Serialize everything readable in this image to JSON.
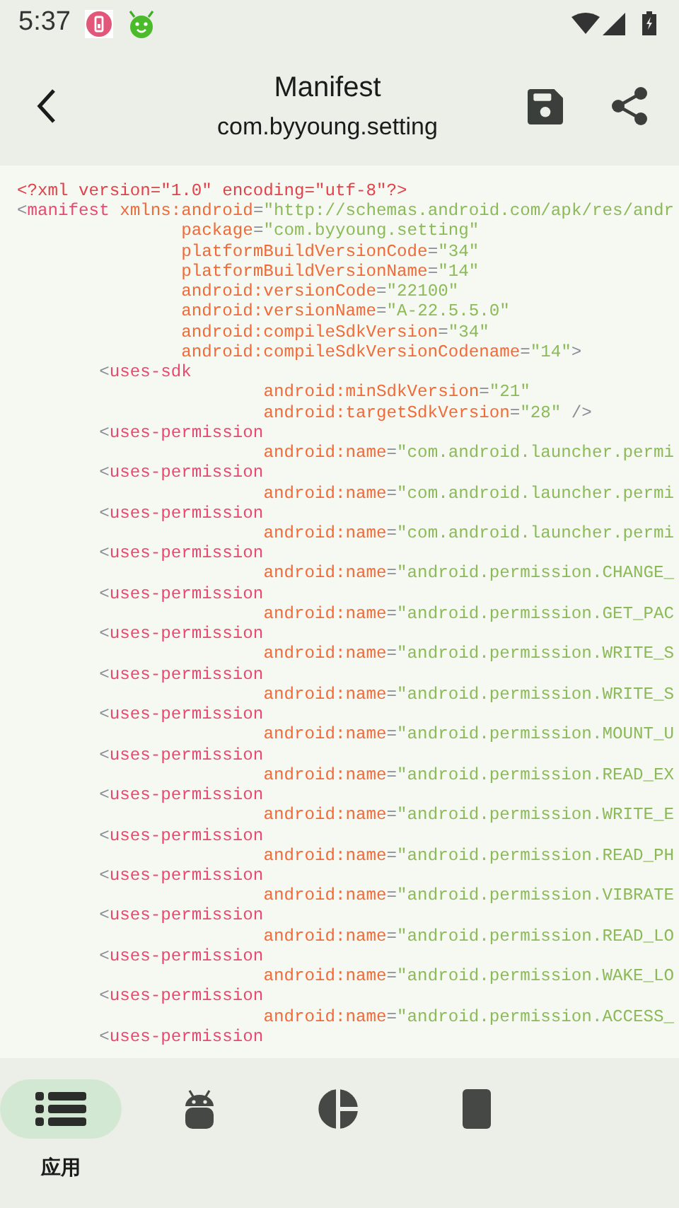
{
  "status_bar": {
    "time": "5:37"
  },
  "app_bar": {
    "title": "Manifest",
    "subtitle": "com.byyoung.setting"
  },
  "code_lines": [
    {
      "tokens": [
        {
          "kind": "decl",
          "text": "<?xml version=\"1.0\" encoding=\"utf-8\"?>"
        }
      ]
    },
    {
      "tokens": [
        {
          "kind": "punct",
          "text": "<"
        },
        {
          "kind": "tag",
          "text": "manifest "
        },
        {
          "kind": "attr",
          "text": "xmlns:android"
        },
        {
          "kind": "punct",
          "text": "="
        },
        {
          "kind": "value",
          "text": "\"http://schemas.android.com/apk/res/andr"
        }
      ]
    },
    {
      "tokens": [
        {
          "kind": "attr",
          "text": "                package"
        },
        {
          "kind": "punct",
          "text": "="
        },
        {
          "kind": "value",
          "text": "\"com.byyoung.setting\""
        }
      ]
    },
    {
      "tokens": [
        {
          "kind": "attr",
          "text": "                platformBuildVersionCode"
        },
        {
          "kind": "punct",
          "text": "="
        },
        {
          "kind": "value",
          "text": "\"34\""
        }
      ]
    },
    {
      "tokens": [
        {
          "kind": "attr",
          "text": "                platformBuildVersionName"
        },
        {
          "kind": "punct",
          "text": "="
        },
        {
          "kind": "value",
          "text": "\"14\""
        }
      ]
    },
    {
      "tokens": [
        {
          "kind": "attr",
          "text": "                android:versionCode"
        },
        {
          "kind": "punct",
          "text": "="
        },
        {
          "kind": "value",
          "text": "\"22100\""
        }
      ]
    },
    {
      "tokens": [
        {
          "kind": "attr",
          "text": "                android:versionName"
        },
        {
          "kind": "punct",
          "text": "="
        },
        {
          "kind": "value",
          "text": "\"A-22.5.5.0\""
        }
      ]
    },
    {
      "tokens": [
        {
          "kind": "attr",
          "text": "                android:compileSdkVersion"
        },
        {
          "kind": "punct",
          "text": "="
        },
        {
          "kind": "value",
          "text": "\"34\""
        }
      ]
    },
    {
      "tokens": [
        {
          "kind": "attr",
          "text": "                android:compileSdkVersionCodename"
        },
        {
          "kind": "punct",
          "text": "="
        },
        {
          "kind": "value",
          "text": "\"14\""
        },
        {
          "kind": "punct",
          "text": ">"
        }
      ]
    },
    {
      "tokens": [
        {
          "kind": "punct",
          "text": "        <"
        },
        {
          "kind": "tag",
          "text": "uses-sdk"
        }
      ]
    },
    {
      "tokens": [
        {
          "kind": "attr",
          "text": "                        android:minSdkVersion"
        },
        {
          "kind": "punct",
          "text": "="
        },
        {
          "kind": "value",
          "text": "\"21\""
        }
      ]
    },
    {
      "tokens": [
        {
          "kind": "attr",
          "text": "                        android:targetSdkVersion"
        },
        {
          "kind": "punct",
          "text": "="
        },
        {
          "kind": "value",
          "text": "\"28\""
        },
        {
          "kind": "punct",
          "text": " />"
        }
      ]
    },
    {
      "tokens": [
        {
          "kind": "punct",
          "text": "        <"
        },
        {
          "kind": "tag",
          "text": "uses-permission"
        }
      ]
    },
    {
      "tokens": [
        {
          "kind": "attr",
          "text": "                        android:name"
        },
        {
          "kind": "punct",
          "text": "="
        },
        {
          "kind": "value",
          "text": "\"com.android.launcher.permi"
        }
      ]
    },
    {
      "tokens": [
        {
          "kind": "punct",
          "text": "        <"
        },
        {
          "kind": "tag",
          "text": "uses-permission"
        }
      ]
    },
    {
      "tokens": [
        {
          "kind": "attr",
          "text": "                        android:name"
        },
        {
          "kind": "punct",
          "text": "="
        },
        {
          "kind": "value",
          "text": "\"com.android.launcher.permi"
        }
      ]
    },
    {
      "tokens": [
        {
          "kind": "punct",
          "text": "        <"
        },
        {
          "kind": "tag",
          "text": "uses-permission"
        }
      ]
    },
    {
      "tokens": [
        {
          "kind": "attr",
          "text": "                        android:name"
        },
        {
          "kind": "punct",
          "text": "="
        },
        {
          "kind": "value",
          "text": "\"com.android.launcher.permi"
        }
      ]
    },
    {
      "tokens": [
        {
          "kind": "punct",
          "text": "        <"
        },
        {
          "kind": "tag",
          "text": "uses-permission"
        }
      ]
    },
    {
      "tokens": [
        {
          "kind": "attr",
          "text": "                        android:name"
        },
        {
          "kind": "punct",
          "text": "="
        },
        {
          "kind": "value",
          "text": "\"android.permission.CHANGE_"
        }
      ]
    },
    {
      "tokens": [
        {
          "kind": "punct",
          "text": "        <"
        },
        {
          "kind": "tag",
          "text": "uses-permission"
        }
      ]
    },
    {
      "tokens": [
        {
          "kind": "attr",
          "text": "                        android:name"
        },
        {
          "kind": "punct",
          "text": "="
        },
        {
          "kind": "value",
          "text": "\"android.permission.GET_PAC"
        }
      ]
    },
    {
      "tokens": [
        {
          "kind": "punct",
          "text": "        <"
        },
        {
          "kind": "tag",
          "text": "uses-permission"
        }
      ]
    },
    {
      "tokens": [
        {
          "kind": "attr",
          "text": "                        android:name"
        },
        {
          "kind": "punct",
          "text": "="
        },
        {
          "kind": "value",
          "text": "\"android.permission.WRITE_S"
        }
      ]
    },
    {
      "tokens": [
        {
          "kind": "punct",
          "text": "        <"
        },
        {
          "kind": "tag",
          "text": "uses-permission"
        }
      ]
    },
    {
      "tokens": [
        {
          "kind": "attr",
          "text": "                        android:name"
        },
        {
          "kind": "punct",
          "text": "="
        },
        {
          "kind": "value",
          "text": "\"android.permission.WRITE_S"
        }
      ]
    },
    {
      "tokens": [
        {
          "kind": "punct",
          "text": "        <"
        },
        {
          "kind": "tag",
          "text": "uses-permission"
        }
      ]
    },
    {
      "tokens": [
        {
          "kind": "attr",
          "text": "                        android:name"
        },
        {
          "kind": "punct",
          "text": "="
        },
        {
          "kind": "value",
          "text": "\"android.permission.MOUNT_U"
        }
      ]
    },
    {
      "tokens": [
        {
          "kind": "punct",
          "text": "        <"
        },
        {
          "kind": "tag",
          "text": "uses-permission"
        }
      ]
    },
    {
      "tokens": [
        {
          "kind": "attr",
          "text": "                        android:name"
        },
        {
          "kind": "punct",
          "text": "="
        },
        {
          "kind": "value",
          "text": "\"android.permission.READ_EX"
        }
      ]
    },
    {
      "tokens": [
        {
          "kind": "punct",
          "text": "        <"
        },
        {
          "kind": "tag",
          "text": "uses-permission"
        }
      ]
    },
    {
      "tokens": [
        {
          "kind": "attr",
          "text": "                        android:name"
        },
        {
          "kind": "punct",
          "text": "="
        },
        {
          "kind": "value",
          "text": "\"android.permission.WRITE_E"
        }
      ]
    },
    {
      "tokens": [
        {
          "kind": "punct",
          "text": "        <"
        },
        {
          "kind": "tag",
          "text": "uses-permission"
        }
      ]
    },
    {
      "tokens": [
        {
          "kind": "attr",
          "text": "                        android:name"
        },
        {
          "kind": "punct",
          "text": "="
        },
        {
          "kind": "value",
          "text": "\"android.permission.READ_PH"
        }
      ]
    },
    {
      "tokens": [
        {
          "kind": "punct",
          "text": "        <"
        },
        {
          "kind": "tag",
          "text": "uses-permission"
        }
      ]
    },
    {
      "tokens": [
        {
          "kind": "attr",
          "text": "                        android:name"
        },
        {
          "kind": "punct",
          "text": "="
        },
        {
          "kind": "value",
          "text": "\"android.permission.VIBRATE"
        }
      ]
    },
    {
      "tokens": [
        {
          "kind": "punct",
          "text": "        <"
        },
        {
          "kind": "tag",
          "text": "uses-permission"
        }
      ]
    },
    {
      "tokens": [
        {
          "kind": "attr",
          "text": "                        android:name"
        },
        {
          "kind": "punct",
          "text": "="
        },
        {
          "kind": "value",
          "text": "\"android.permission.READ_LO"
        }
      ]
    },
    {
      "tokens": [
        {
          "kind": "punct",
          "text": "        <"
        },
        {
          "kind": "tag",
          "text": "uses-permission"
        }
      ]
    },
    {
      "tokens": [
        {
          "kind": "attr",
          "text": "                        android:name"
        },
        {
          "kind": "punct",
          "text": "="
        },
        {
          "kind": "value",
          "text": "\"android.permission.WAKE_LO"
        }
      ]
    },
    {
      "tokens": [
        {
          "kind": "punct",
          "text": "        <"
        },
        {
          "kind": "tag",
          "text": "uses-permission"
        }
      ]
    },
    {
      "tokens": [
        {
          "kind": "attr",
          "text": "                        android:name"
        },
        {
          "kind": "punct",
          "text": "="
        },
        {
          "kind": "value",
          "text": "\"android.permission.ACCESS_"
        }
      ]
    },
    {
      "tokens": [
        {
          "kind": "punct",
          "text": "        <"
        },
        {
          "kind": "tag",
          "text": "uses-permission"
        }
      ]
    }
  ],
  "bottom_nav": [
    {
      "label": "应用",
      "selected": true
    },
    {
      "selected": false
    },
    {
      "selected": false
    },
    {
      "selected": false
    }
  ]
}
